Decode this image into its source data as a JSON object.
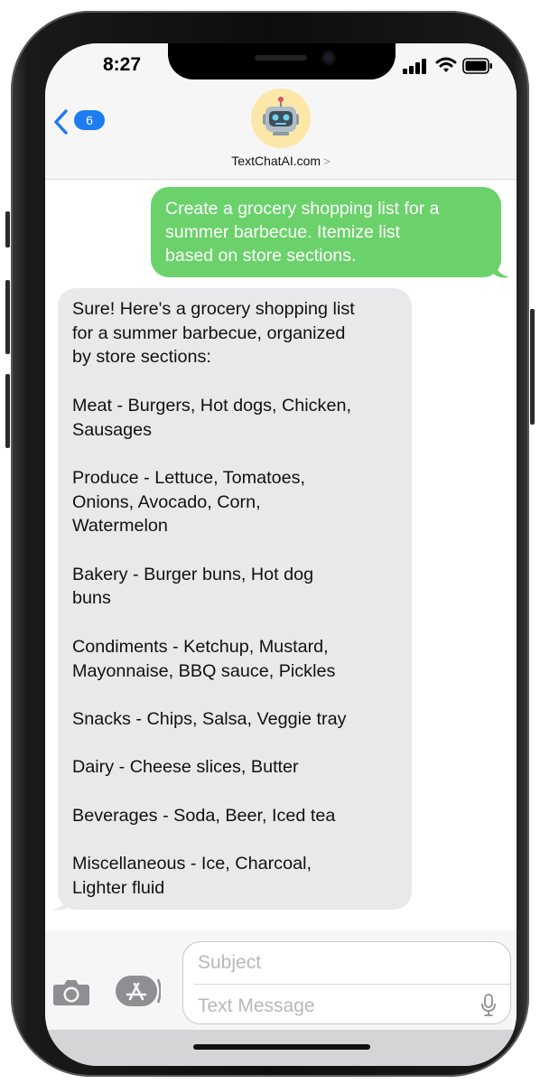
{
  "status_bar": {
    "time": "8:27",
    "icons": [
      "cellular-signal-icon",
      "wifi-icon",
      "battery-icon"
    ]
  },
  "header": {
    "back_count": "6",
    "contact_name": "TextChatAI.com",
    "avatar_icon": "robot-emoji-icon",
    "chevron": ">"
  },
  "messages": [
    {
      "direction": "outgoing",
      "text": "Create a grocery shopping list for a\nsummer barbecue. Itemize list\nbased on store sections."
    },
    {
      "direction": "incoming",
      "text": "Sure! Here's a grocery shopping list\nfor a summer barbecue, organized\nby store sections:\n\nMeat - Burgers, Hot dogs, Chicken,\nSausages\n\nProduce - Lettuce, Tomatoes,\nOnions, Avocado, Corn,\nWatermelon\n\nBakery - Burger buns, Hot dog\nbuns\n\nCondiments - Ketchup, Mustard,\nMayonnaise, BBQ sauce, Pickles\n\nSnacks - Chips, Salsa, Veggie tray\n\nDairy - Cheese slices, Butter\n\nBeverages - Soda, Beer, Iced tea\n\nMiscellaneous - Ice, Charcoal,\nLighter fluid"
    }
  ],
  "composer": {
    "subject_placeholder": "Subject",
    "message_placeholder": "Text Message",
    "camera_icon": "camera-icon",
    "apps_icon": "app-store-icon",
    "mic_icon": "microphone-icon"
  },
  "colors": {
    "outgoing_bubble": "#6bd26b",
    "incoming_bubble": "#e9e9eb",
    "accent_blue": "#1d7cf2"
  }
}
